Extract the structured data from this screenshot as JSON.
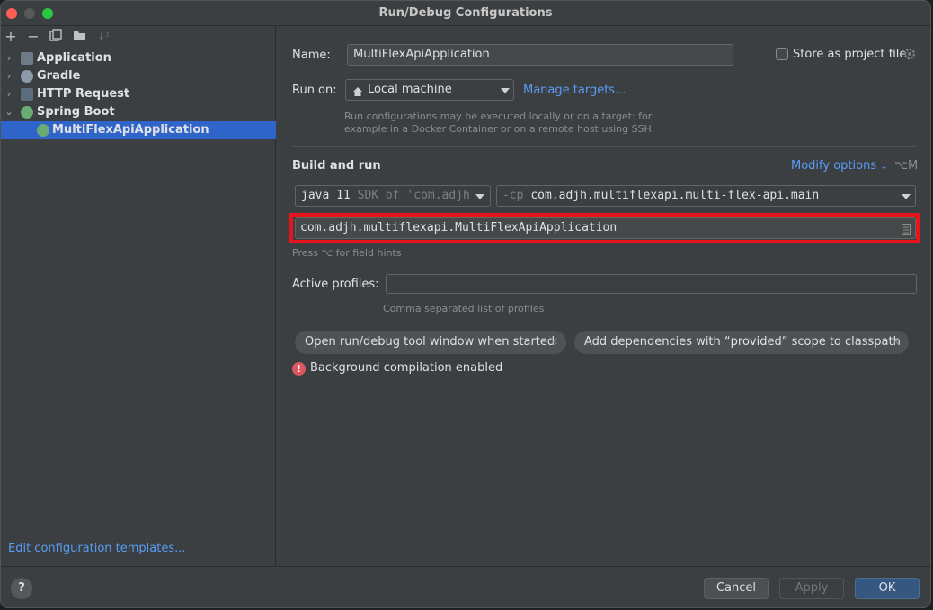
{
  "window": {
    "title": "Run/Debug Configurations"
  },
  "toolbar": {
    "add_icon": "plus-icon",
    "remove_icon": "minus-icon",
    "copy_icon": "copy-icon",
    "folder_icon": "new-folder-icon",
    "sort_icon": "sort-icon"
  },
  "tree": {
    "items": [
      {
        "label": "Application",
        "icon": "application-icon",
        "expanded": false
      },
      {
        "label": "Gradle",
        "icon": "gradle-icon",
        "expanded": false
      },
      {
        "label": "HTTP Request",
        "icon": "http-request-icon",
        "expanded": false
      },
      {
        "label": "Spring Boot",
        "icon": "spring-boot-icon",
        "expanded": true
      },
      {
        "label": "MultiFlexApiApplication",
        "icon": "spring-boot-run-icon",
        "selected": true
      }
    ],
    "edit_templates_label": "Edit configuration templates..."
  },
  "form": {
    "name_label": "Name:",
    "name_value": "MultiFlexApiApplication",
    "store_label": "Store as project file",
    "run_on_label": "Run on:",
    "run_on_value": "Local machine",
    "manage_targets_label": "Manage targets...",
    "run_on_hint_1": "Run configurations may be executed locally or on a target: for",
    "run_on_hint_2": "example in a Docker Container or on a remote host using SSH.",
    "section_title": "Build and run",
    "modify_options_label": "Modify options",
    "modify_options_shortcut": "⌥M",
    "jdk_value": "java 11",
    "jdk_hint": "SDK of 'com.adjh",
    "cp_prefix": "-cp",
    "cp_value": "com.adjh.multiflexapi.multi-flex-api.main",
    "main_class_value": "com.adjh.multiflexapi.MultiFlexApiApplication",
    "field_hint": "Press ⌥ for field hints",
    "profiles_label": "Active profiles:",
    "profiles_value": "",
    "profiles_hint": "Comma separated list of profiles",
    "chips": [
      "Open run/debug tool window when started",
      "Add dependencies with “provided” scope to classpath"
    ],
    "warning_text": "Background compilation enabled"
  },
  "footer": {
    "help_label": "?",
    "cancel_label": "Cancel",
    "apply_label": "Apply",
    "ok_label": "OK"
  },
  "colors": {
    "accent": "#2f65ca",
    "link": "#589df6",
    "highlight": "#e8141d",
    "warning": "#db5860"
  }
}
